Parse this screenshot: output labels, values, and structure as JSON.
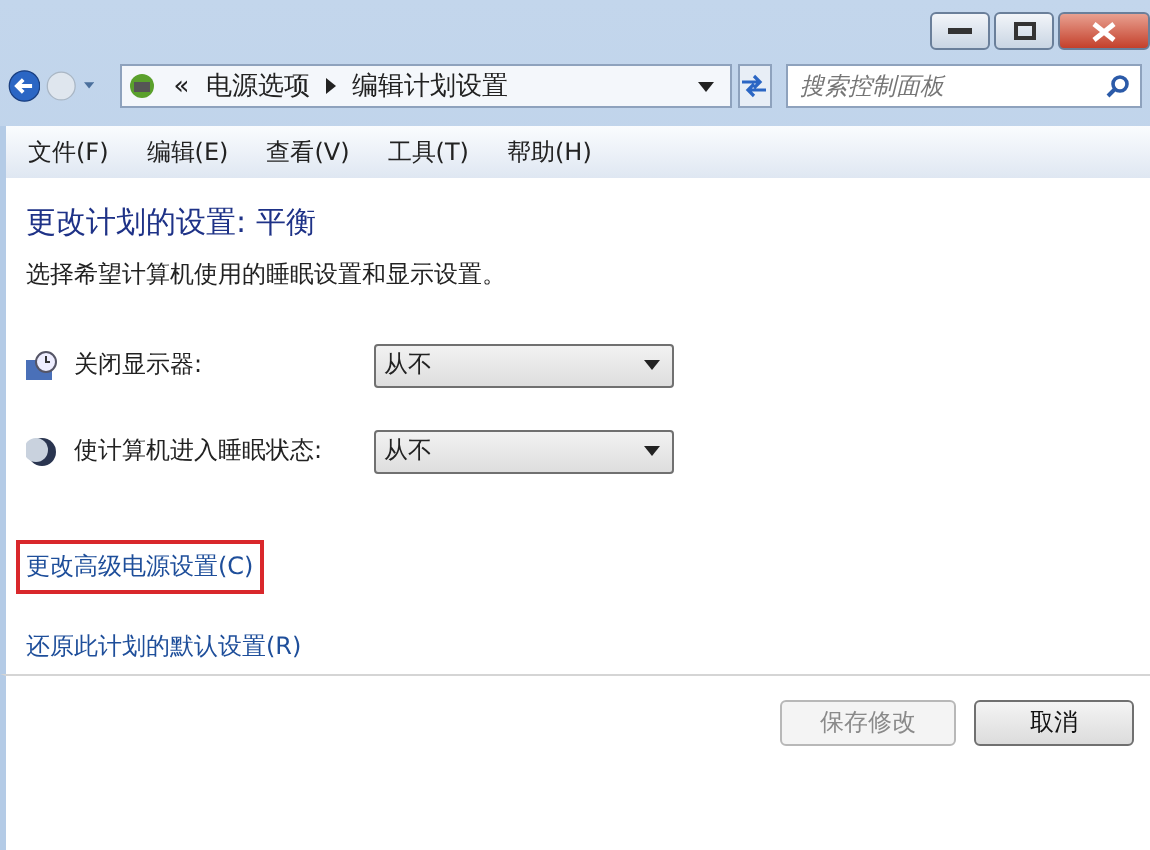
{
  "address_bar": {
    "overflow": "«",
    "crumbs": [
      "电源选项",
      "编辑计划设置"
    ]
  },
  "search": {
    "placeholder": "搜索控制面板"
  },
  "menu": [
    "文件(F)",
    "编辑(E)",
    "查看(V)",
    "工具(T)",
    "帮助(H)"
  ],
  "heading": "更改计划的设置: 平衡",
  "description": "选择希望计算机使用的睡眠设置和显示设置。",
  "settings": [
    {
      "kind": "display",
      "label": "关闭显示器:",
      "value": "从不"
    },
    {
      "kind": "sleep",
      "label": "使计算机进入睡眠状态:",
      "value": "从不"
    }
  ],
  "links": [
    {
      "label": "更改高级电源设置(C)",
      "highlighted": true
    },
    {
      "label": "还原此计划的默认设置(R)",
      "highlighted": false
    }
  ],
  "buttons": [
    {
      "label": "保存修改",
      "disabled": true
    },
    {
      "label": "取消",
      "disabled": false
    }
  ]
}
